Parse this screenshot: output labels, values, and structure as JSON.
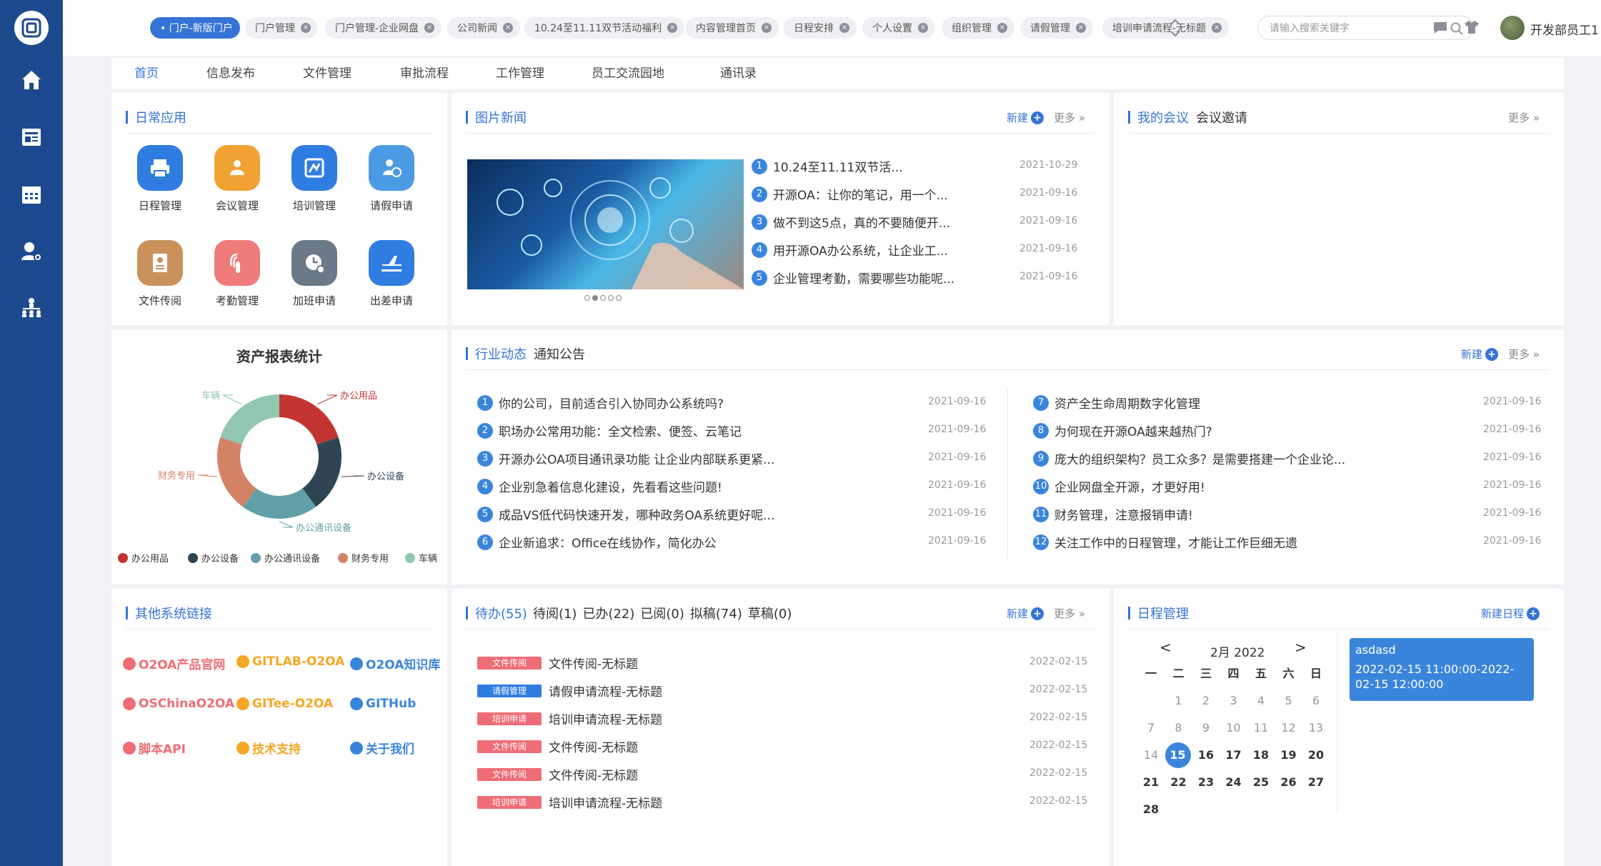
{
  "tabs": [
    {
      "label": "门户-新版门户",
      "active": true
    },
    {
      "label": "门户管理"
    },
    {
      "label": "门户管理-企业网盘"
    },
    {
      "label": "公司新闻"
    },
    {
      "label": "10.24至11.11双节活动福利"
    },
    {
      "label": "内容管理首页"
    },
    {
      "label": "日程安排"
    },
    {
      "label": "个人设置"
    },
    {
      "label": "组织管理"
    },
    {
      "label": "请假管理"
    },
    {
      "label": "培训申请流程-无标题"
    }
  ],
  "search_placeholder": "请输入搜索关键字",
  "user_name": "开发部员工1",
  "nav": [
    "首页",
    "信息发布",
    "文件管理",
    "审批流程",
    "工作管理",
    "员工交流园地",
    "通讯录"
  ],
  "daily_apps": {
    "title": "日常应用",
    "items": [
      {
        "label": "日程管理",
        "color": "#2f7de1",
        "icon": "printer-icon"
      },
      {
        "label": "会议管理",
        "color": "#f0a232",
        "icon": "meeting-icon"
      },
      {
        "label": "培训管理",
        "color": "#2f7de1",
        "icon": "training-icon"
      },
      {
        "label": "请假申请",
        "color": "#4a9be3",
        "icon": "leave-icon"
      },
      {
        "label": "文件传阅",
        "color": "#c9925a",
        "icon": "document-icon"
      },
      {
        "label": "考勤管理",
        "color": "#ef7b7b",
        "icon": "fingerprint-icon"
      },
      {
        "label": "加班申请",
        "color": "#6b7a89",
        "icon": "clock-icon"
      },
      {
        "label": "出差申请",
        "color": "#2f7de1",
        "icon": "plane-icon"
      }
    ]
  },
  "picture_news": {
    "title": "图片新闻",
    "new_label": "新建",
    "more_label": "更多",
    "items": [
      {
        "n": "1",
        "text": "10.24至11.11双节活...",
        "date": "2021-10-29"
      },
      {
        "n": "2",
        "text": "开源OA：让你的笔记，用一个...",
        "date": "2021-09-16"
      },
      {
        "n": "3",
        "text": "做不到这5点，真的不要随便开...",
        "date": "2021-09-16"
      },
      {
        "n": "4",
        "text": "用开源OA办公系统，让企业工...",
        "date": "2021-09-16"
      },
      {
        "n": "5",
        "text": "企业管理考勤，需要哪些功能呢...",
        "date": "2021-09-16"
      }
    ]
  },
  "meetings": {
    "title": "我的会议",
    "title2": "会议邀请",
    "more_label": "更多"
  },
  "asset_chart": {
    "title": "资产报表统计",
    "chart_data": {
      "type": "pie",
      "title": "资产报表统计",
      "labels": [
        "办公用品",
        "办公设备",
        "办公通讯设备",
        "财务专用",
        "车辆"
      ],
      "values": [
        20,
        20,
        20,
        20,
        20
      ],
      "colors": [
        "#c23531",
        "#2f4554",
        "#61a0a8",
        "#d48265",
        "#91c7ae"
      ],
      "legend_position": "bottom"
    }
  },
  "notices": {
    "title": "行业动态",
    "title2": "通知公告",
    "new_label": "新建",
    "more_label": "更多",
    "left": [
      {
        "n": "1",
        "text": "你的公司，目前适合引入协同办公系统吗?",
        "date": "2021-09-16"
      },
      {
        "n": "2",
        "text": "职场办公常用功能：全文检索、便签、云笔记",
        "date": "2021-09-16"
      },
      {
        "n": "3",
        "text": "开源办公OA项目通讯录功能 让企业内部联系更紧...",
        "date": "2021-09-16"
      },
      {
        "n": "4",
        "text": "企业别急着信息化建设，先看看这些问题!",
        "date": "2021-09-16"
      },
      {
        "n": "5",
        "text": "成品VS低代码快速开发，哪种政务OA系统更好呢...",
        "date": "2021-09-16"
      },
      {
        "n": "6",
        "text": "企业新追求：Office在线协作，简化办公",
        "date": "2021-09-16"
      }
    ],
    "right": [
      {
        "n": "7",
        "text": "资产全生命周期数字化管理",
        "date": "2021-09-16"
      },
      {
        "n": "8",
        "text": "为何现在开源OA越来越热门?",
        "date": "2021-09-16"
      },
      {
        "n": "9",
        "text": "庞大的组织架构？员工众多？是需要搭建一个企业论...",
        "date": "2021-09-16"
      },
      {
        "n": "10",
        "text": "企业网盘全开源，才更好用!",
        "date": "2021-09-16"
      },
      {
        "n": "11",
        "text": "财务管理，注意报销申请!",
        "date": "2021-09-16"
      },
      {
        "n": "12",
        "text": "关注工作中的日程管理，才能让工作巨细无遗",
        "date": "2021-09-16"
      }
    ]
  },
  "links": {
    "title": "其他系统链接",
    "items": [
      {
        "label": "O2OA产品官网",
        "color": "#ef6d75"
      },
      {
        "label": "GITLAB-O2OA",
        "color": "#f5a623"
      },
      {
        "label": "O2OA知识库",
        "color": "#3a85dc"
      },
      {
        "label": "OSChinaO2OA",
        "color": "#ef6d75"
      },
      {
        "label": "GITee-O2OA",
        "color": "#f5a623"
      },
      {
        "label": "GITHub",
        "color": "#3a85dc"
      },
      {
        "label": "脚本API",
        "color": "#ef6d75"
      },
      {
        "label": "技术支持",
        "color": "#f5a623"
      },
      {
        "label": "关于我们",
        "color": "#3a85dc"
      }
    ]
  },
  "tasks": {
    "tab_active": "待办(55)",
    "tabs": [
      "待阅(1)",
      "已办(22)",
      "已阅(0)",
      "拟稿(74)",
      "草稿(0)"
    ],
    "new_label": "新建",
    "more_label": "更多",
    "items": [
      {
        "badge": "文件传阅",
        "badge_color": "#ef6d75",
        "text": "文件传阅-无标题",
        "date": "2022-02-15"
      },
      {
        "badge": "请假管理",
        "badge_color": "#2f7de1",
        "text": "请假申请流程-无标题",
        "date": "2022-02-15"
      },
      {
        "badge": "培训申请",
        "badge_color": "#ef6d75",
        "text": "培训申请流程-无标题",
        "date": "2022-02-15"
      },
      {
        "badge": "文件传阅",
        "badge_color": "#ef6d75",
        "text": "文件传阅-无标题",
        "date": "2022-02-15"
      },
      {
        "badge": "文件传阅",
        "badge_color": "#ef6d75",
        "text": "文件传阅-无标题",
        "date": "2022-02-15"
      },
      {
        "badge": "培训申请",
        "badge_color": "#ef6d75",
        "text": "培训申请流程-无标题",
        "date": "2022-02-15"
      }
    ]
  },
  "schedule": {
    "title": "日程管理",
    "new_label": "新建日程",
    "month": "2月 2022",
    "prev": "<",
    "next": ">",
    "weekdays": [
      "一",
      "二",
      "三",
      "四",
      "五",
      "六",
      "日"
    ],
    "weeks": [
      [
        "",
        "1",
        "2",
        "3",
        "4",
        "5",
        "6"
      ],
      [
        "7",
        "8",
        "9",
        "10",
        "11",
        "12",
        "13"
      ],
      [
        "14",
        "15",
        "16",
        "17",
        "18",
        "19",
        "20"
      ],
      [
        "21",
        "22",
        "23",
        "24",
        "25",
        "26",
        "27"
      ],
      [
        "28",
        "",
        "",
        "",
        "",
        "",
        ""
      ]
    ],
    "today": "15",
    "event": {
      "title": "asdasd",
      "time": "2022-02-15 11:00:00-2022-02-15 12:00:00"
    }
  }
}
